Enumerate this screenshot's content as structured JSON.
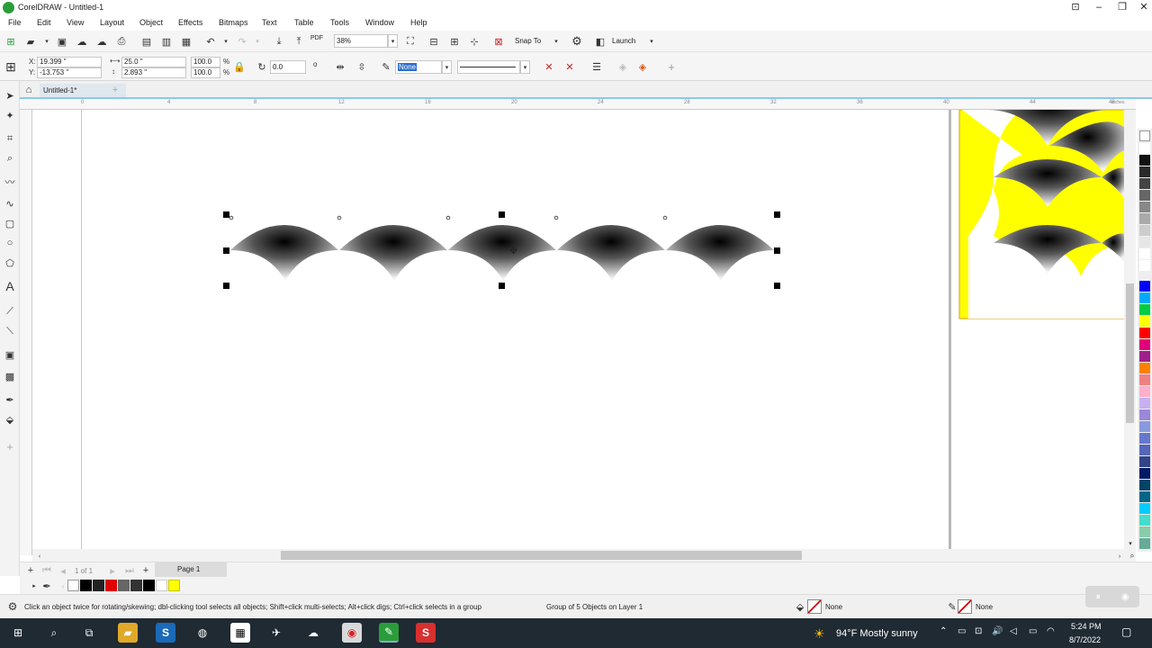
{
  "window": {
    "title": "CorelDRAW - Untitled-1"
  },
  "menu": [
    "File",
    "Edit",
    "View",
    "Layout",
    "Object",
    "Effects",
    "Bitmaps",
    "Text",
    "Table",
    "Tools",
    "Window",
    "Help"
  ],
  "standard_toolbar": {
    "zoom": "38%",
    "snap_to_label": "Snap To",
    "launch_label": "Launch",
    "pdf_label": "PDF"
  },
  "property_bar": {
    "x_label": "X:",
    "x_value": "19.399 \"",
    "y_label": "Y:",
    "y_value": "-13.753 \"",
    "width_value": "25.0 \"",
    "height_value": "2.893 \"",
    "scale_w": "100.0",
    "scale_h": "100.0",
    "percent": "%",
    "rotation": "0.0",
    "degree": "o",
    "outline_width": "None"
  },
  "document_tab": {
    "label": "Untitled-1*"
  },
  "ruler": {
    "units": "inches",
    "ticks": [
      "0",
      "4",
      "8",
      "12",
      "16",
      "20",
      "24",
      "28",
      "32",
      "36",
      "40",
      "44",
      "48"
    ]
  },
  "page_nav": {
    "count": "1 of 1",
    "page_tab": "Page 1"
  },
  "status": {
    "hint": "Click an object twice for rotating/skewing; dbl-clicking tool selects all objects; Shift+click multi-selects; Alt+click digs; Ctrl+click selects in a group",
    "selection": "Group of 5 Objects on Layer 1",
    "fill_label": "None",
    "outline_label": "None"
  },
  "taskbar": {
    "weather": "94°F  Mostly sunny",
    "time": "5:24 PM",
    "date": "8/7/2022"
  },
  "colors": {
    "accent_green": "#2a9d3a",
    "yellow_page": "#ffff00",
    "selection_handle": "#000000",
    "taskbar": "#1f2a33"
  }
}
